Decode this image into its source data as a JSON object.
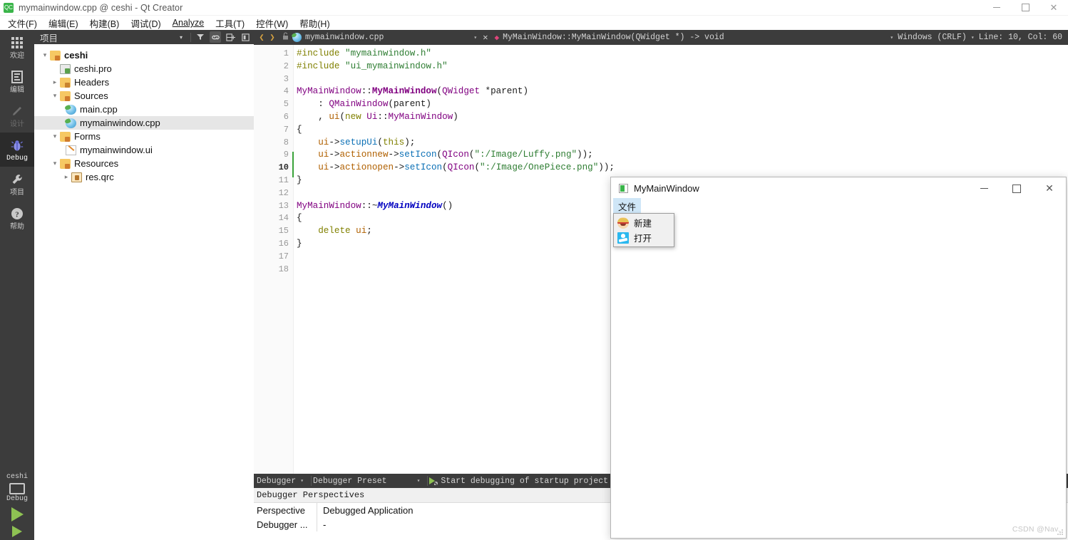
{
  "window": {
    "title": "mymainwindow.cpp @ ceshi - Qt Creator",
    "app_icon": "qt-creator-icon",
    "controls": {
      "minimize": "—",
      "maximize": "❐",
      "close": "✕"
    }
  },
  "menubar": {
    "items": [
      {
        "label": "文件(F)",
        "name": "menu-file"
      },
      {
        "label": "编辑(E)",
        "name": "menu-edit"
      },
      {
        "label": "构建(B)",
        "name": "menu-build"
      },
      {
        "label": "调试(D)",
        "name": "menu-debug"
      },
      {
        "label": "Analyze",
        "name": "menu-analyze"
      },
      {
        "label": "工具(T)",
        "name": "menu-tools"
      },
      {
        "label": "控件(W)",
        "name": "menu-window"
      },
      {
        "label": "帮助(H)",
        "name": "menu-help"
      }
    ]
  },
  "modebar": {
    "items": [
      {
        "label": "欢迎",
        "icon": "grid-icon",
        "state": "normal"
      },
      {
        "label": "编辑",
        "icon": "document-icon",
        "state": "normal"
      },
      {
        "label": "设计",
        "icon": "pencil-icon",
        "state": "disabled"
      },
      {
        "label": "Debug",
        "icon": "bug-icon",
        "state": "active"
      },
      {
        "label": "项目",
        "icon": "wrench-icon",
        "state": "normal"
      },
      {
        "label": "帮助",
        "icon": "question-icon",
        "state": "normal"
      }
    ],
    "kit": {
      "project": "ceshi",
      "build_config": "Debug",
      "icon": "monitor-icon"
    },
    "run_buttons": [
      {
        "name": "run-button",
        "icon": "play-icon"
      },
      {
        "name": "debug-run-button",
        "icon": "play-small-icon"
      }
    ]
  },
  "project_panel": {
    "title": "项目",
    "toolbar": [
      {
        "name": "filter-dropdown",
        "icon": "chevron-down-icon"
      },
      {
        "name": "filter-tree-button",
        "icon": "filter-icon"
      },
      {
        "name": "sync-selection-button",
        "icon": "link-icon",
        "pressed": true
      },
      {
        "name": "split-button",
        "icon": "split-icon"
      },
      {
        "name": "close-sidebar-button",
        "icon": "close-panel-icon"
      }
    ],
    "tree": [
      {
        "label": "ceshi",
        "icon": "project-folder-icon",
        "indent": 0,
        "expander": "expanded",
        "bold": true,
        "selected": false
      },
      {
        "label": "ceshi.pro",
        "icon": "pro-file-icon",
        "indent": 1,
        "expander": "none",
        "bold": false,
        "selected": false
      },
      {
        "label": "Headers",
        "icon": "headers-folder-icon",
        "indent": 1,
        "expander": "collapsed",
        "bold": false,
        "selected": false
      },
      {
        "label": "Sources",
        "icon": "sources-folder-icon",
        "indent": 1,
        "expander": "expanded",
        "bold": false,
        "selected": false
      },
      {
        "label": "main.cpp",
        "icon": "cpp-file-icon",
        "indent": 2,
        "expander": "none",
        "bold": false,
        "selected": false
      },
      {
        "label": "mymainwindow.cpp",
        "icon": "cpp-file-icon",
        "indent": 2,
        "expander": "none",
        "bold": false,
        "selected": true
      },
      {
        "label": "Forms",
        "icon": "forms-folder-icon",
        "indent": 1,
        "expander": "expanded",
        "bold": false,
        "selected": false
      },
      {
        "label": "mymainwindow.ui",
        "icon": "ui-file-icon",
        "indent": 2,
        "expander": "none",
        "bold": false,
        "selected": false
      },
      {
        "label": "Resources",
        "icon": "resources-folder-icon",
        "indent": 1,
        "expander": "expanded",
        "bold": false,
        "selected": false
      },
      {
        "label": "res.qrc",
        "icon": "qrc-file-icon",
        "indent": 2,
        "expander": "collapsed",
        "bold": false,
        "selected": false
      }
    ]
  },
  "editor": {
    "toolbar": {
      "back": "❮",
      "forward": "❯",
      "lock_icon": "unlocked-icon",
      "file_name": "mymainwindow.cpp",
      "file_dropdown": "▾",
      "close_button": "✕",
      "symbol_marker": "◆",
      "symbol": "MyMainWindow::MyMainWindow(QWidget *) -> void",
      "symbol_dropdown": "▾",
      "line_ending": "Windows (CRLF)",
      "line_ending_dropdown": "▾",
      "cursor_position": "Line: 10, Col: 60"
    },
    "current_line": 10,
    "total_lines": 18,
    "fold_markers": [
      6,
      13
    ],
    "lines": [
      {
        "n": 1,
        "tokens": [
          {
            "t": "#include ",
            "c": "k-pre"
          },
          {
            "t": "\"mymainwindow.h\"",
            "c": "k-str"
          }
        ]
      },
      {
        "n": 2,
        "tokens": [
          {
            "t": "#include ",
            "c": "k-pre"
          },
          {
            "t": "\"ui_mymainwindow.h\"",
            "c": "k-str"
          }
        ]
      },
      {
        "n": 3,
        "tokens": []
      },
      {
        "n": 4,
        "tokens": [
          {
            "t": "MyMainWindow",
            "c": "k-type"
          },
          {
            "t": "::",
            "c": "k-plain"
          },
          {
            "t": "MyMainWindow",
            "c": "k-typeb"
          },
          {
            "t": "(",
            "c": "k-plain"
          },
          {
            "t": "QWidget",
            "c": "k-type"
          },
          {
            "t": " *parent)",
            "c": "k-plain"
          }
        ]
      },
      {
        "n": 5,
        "tokens": [
          {
            "t": "    : ",
            "c": "k-plain"
          },
          {
            "t": "QMainWindow",
            "c": "k-type"
          },
          {
            "t": "(parent)",
            "c": "k-plain"
          }
        ]
      },
      {
        "n": 6,
        "tokens": [
          {
            "t": "    , ",
            "c": "k-plain"
          },
          {
            "t": "ui",
            "c": "k-fld"
          },
          {
            "t": "(",
            "c": "k-plain"
          },
          {
            "t": "new",
            "c": "k-kw"
          },
          {
            "t": " ",
            "c": "k-plain"
          },
          {
            "t": "Ui",
            "c": "k-type"
          },
          {
            "t": "::",
            "c": "k-plain"
          },
          {
            "t": "MyMainWindow",
            "c": "k-type"
          },
          {
            "t": ")",
            "c": "k-plain"
          }
        ]
      },
      {
        "n": 7,
        "tokens": [
          {
            "t": "{",
            "c": "k-plain"
          }
        ]
      },
      {
        "n": 8,
        "tokens": [
          {
            "t": "    ",
            "c": "k-plain"
          },
          {
            "t": "ui",
            "c": "k-fld"
          },
          {
            "t": "->",
            "c": "k-plain"
          },
          {
            "t": "setupUi",
            "c": "k-fn"
          },
          {
            "t": "(",
            "c": "k-plain"
          },
          {
            "t": "this",
            "c": "k-kw"
          },
          {
            "t": ");",
            "c": "k-plain"
          }
        ]
      },
      {
        "n": 9,
        "tokens": [
          {
            "t": "    ",
            "c": "k-plain"
          },
          {
            "t": "ui",
            "c": "k-fld"
          },
          {
            "t": "->",
            "c": "k-plain"
          },
          {
            "t": "actionnew",
            "c": "k-fld"
          },
          {
            "t": "->",
            "c": "k-plain"
          },
          {
            "t": "setIcon",
            "c": "k-fn"
          },
          {
            "t": "(",
            "c": "k-plain"
          },
          {
            "t": "QIcon",
            "c": "k-type"
          },
          {
            "t": "(",
            "c": "k-plain"
          },
          {
            "t": "\":/Image/Luffy.png\"",
            "c": "k-str"
          },
          {
            "t": "));",
            "c": "k-plain"
          }
        ]
      },
      {
        "n": 10,
        "tokens": [
          {
            "t": "    ",
            "c": "k-plain"
          },
          {
            "t": "ui",
            "c": "k-fld"
          },
          {
            "t": "->",
            "c": "k-plain"
          },
          {
            "t": "actionopen",
            "c": "k-fld"
          },
          {
            "t": "->",
            "c": "k-plain"
          },
          {
            "t": "setIcon",
            "c": "k-fn"
          },
          {
            "t": "(",
            "c": "k-plain"
          },
          {
            "t": "QIcon",
            "c": "k-type"
          },
          {
            "t": "(",
            "c": "k-plain"
          },
          {
            "t": "\":/Image/OnePiece.png\"",
            "c": "k-str"
          },
          {
            "t": "));",
            "c": "k-plain"
          }
        ]
      },
      {
        "n": 11,
        "tokens": [
          {
            "t": "}",
            "c": "k-plain"
          }
        ]
      },
      {
        "n": 12,
        "tokens": []
      },
      {
        "n": 13,
        "tokens": [
          {
            "t": "MyMainWindow",
            "c": "k-type"
          },
          {
            "t": "::~",
            "c": "k-plain"
          },
          {
            "t": "MyMainWindow",
            "c": "k-typei"
          },
          {
            "t": "()",
            "c": "k-plain"
          }
        ]
      },
      {
        "n": 14,
        "tokens": [
          {
            "t": "{",
            "c": "k-plain"
          }
        ]
      },
      {
        "n": 15,
        "tokens": [
          {
            "t": "    ",
            "c": "k-plain"
          },
          {
            "t": "delete",
            "c": "k-kw"
          },
          {
            "t": " ",
            "c": "k-plain"
          },
          {
            "t": "ui",
            "c": "k-fld"
          },
          {
            "t": ";",
            "c": "k-plain"
          }
        ]
      },
      {
        "n": 16,
        "tokens": [
          {
            "t": "}",
            "c": "k-plain"
          }
        ]
      },
      {
        "n": 17,
        "tokens": []
      },
      {
        "n": 18,
        "tokens": []
      }
    ]
  },
  "debugger_pane": {
    "toolbar": {
      "label": "Debugger",
      "label_dropdown": "▾",
      "preset": "Debugger Preset",
      "preset_dropdown": "▾",
      "start_icon": "start-debug-icon",
      "start_text": "Start debugging of startup project"
    },
    "subtitle": "Debugger Perspectives",
    "rows": [
      {
        "key": "Perspective",
        "value": "Debugged Application"
      },
      {
        "key": "Debugger ...",
        "value": "-"
      }
    ]
  },
  "mymainwindow": {
    "title": "MyMainWindow",
    "icon": "app-window-icon",
    "controls": {
      "minimize": "—",
      "maximize": "❐",
      "close": "✕"
    },
    "menubar": [
      {
        "label": "文件",
        "open": true
      }
    ],
    "popup_menu": [
      {
        "label": "新建",
        "icon": "luffy-icon"
      },
      {
        "label": "打开",
        "icon": "onepiece-skull-icon"
      }
    ]
  },
  "watermark": "CSDN @Nav.",
  "colors": {
    "accent_green": "#8ec253",
    "modebar_bg": "#3c3c3c",
    "modebar_active_bg": "#2b2b2b",
    "selection": "#e6e6e6",
    "menu_open": "#cfe6f7",
    "string": "#2e7d32",
    "type": "#800080",
    "function": "#0a6fb5",
    "preprocessor": "#808000"
  }
}
